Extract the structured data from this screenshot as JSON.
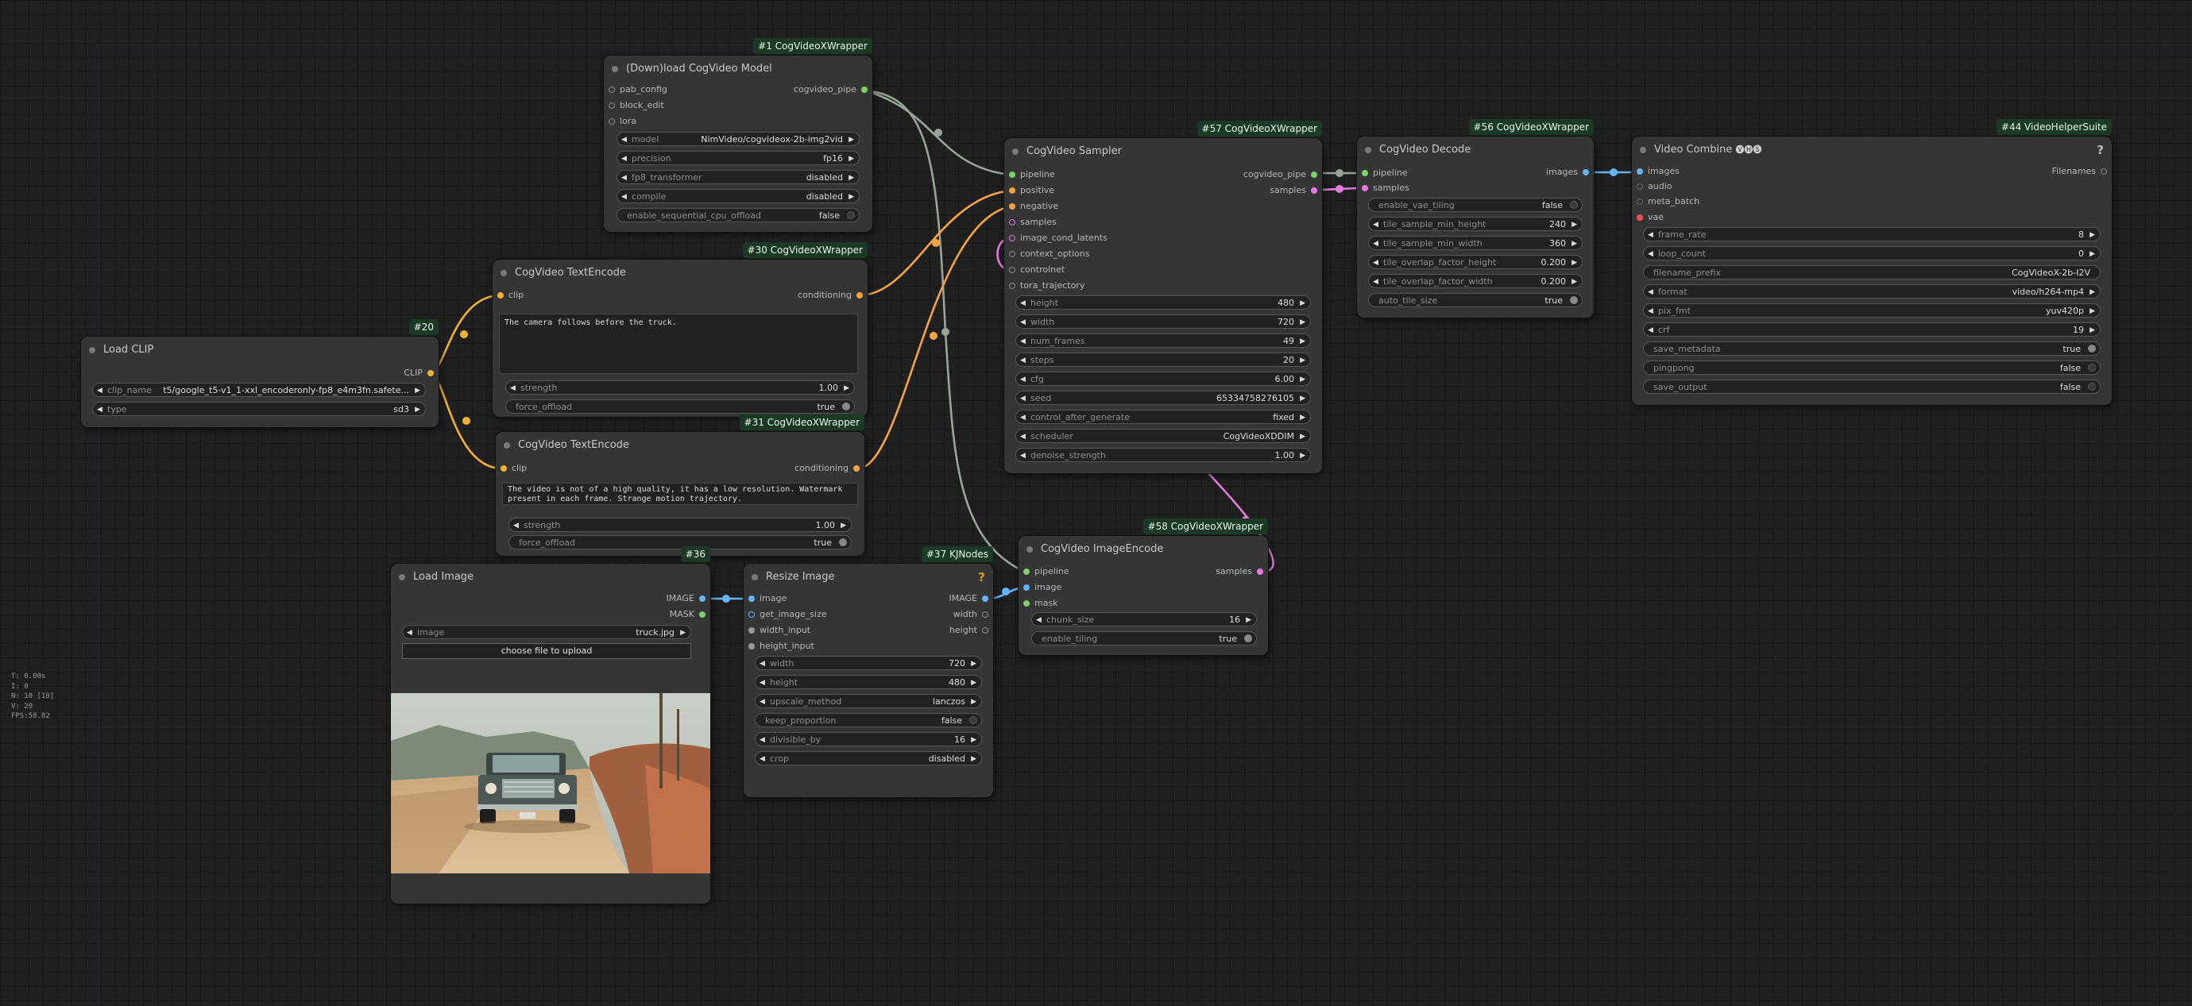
{
  "stats": [
    "T: 0.00s",
    "I: 0",
    "N: 10 [10]",
    "V: 20",
    "FPS:58.82"
  ],
  "nodes": {
    "load_model": {
      "badge": "#1 CogVideoXWrapper",
      "title": "(Down)load CogVideo Model",
      "inputs": [
        "pab_config",
        "block_edit",
        "lora"
      ],
      "output": "cogvideo_pipe",
      "widgets": [
        {
          "label": "model",
          "value": "NimVideo/cogvideox-2b-img2vid"
        },
        {
          "label": "precision",
          "value": "fp16"
        },
        {
          "label": "fp8_transformer",
          "value": "disabled"
        },
        {
          "label": "compile",
          "value": "disabled"
        }
      ],
      "toggle": {
        "label": "enable_sequential_cpu_offload",
        "value": "false"
      }
    },
    "text_encode_30": {
      "badge": "#30 CogVideoXWrapper",
      "title": "CogVideo TextEncode",
      "input": "clip",
      "output": "conditioning",
      "text": "The camera follows before the truck.",
      "strength_label": "strength",
      "strength_value": "1.00",
      "offload_label": "force_offload",
      "offload_value": "true"
    },
    "text_encode_31": {
      "badge": "#31 CogVideoXWrapper",
      "title": "CogVideo TextEncode",
      "input": "clip",
      "output": "conditioning",
      "text": "The video is not of a high quality, it has a low resolution. Watermark present in each frame. Strange motion trajectory.",
      "strength_label": "strength",
      "strength_value": "1.00",
      "offload_label": "force_offload",
      "offload_value": "true"
    },
    "load_clip": {
      "badge": "#20",
      "title": "Load CLIP",
      "output": "CLIP",
      "widgets": [
        {
          "label": "clip_name",
          "value": "t5/google_t5-v1_1-xxl_encoderonly-fp8_e4m3fn.safete..."
        },
        {
          "label": "type",
          "value": "sd3"
        }
      ]
    },
    "sampler": {
      "badge": "#57 CogVideoXWrapper",
      "title": "CogVideo Sampler",
      "inputs": [
        "pipeline",
        "positive",
        "negative",
        "samples",
        "image_cond_latents",
        "context_options",
        "controlnet",
        "tora_trajectory"
      ],
      "outputs": [
        "cogvideo_pipe",
        "samples"
      ],
      "widgets": [
        {
          "label": "height",
          "value": "480"
        },
        {
          "label": "width",
          "value": "720"
        },
        {
          "label": "num_frames",
          "value": "49"
        },
        {
          "label": "steps",
          "value": "20"
        },
        {
          "label": "cfg",
          "value": "6.00"
        },
        {
          "label": "seed",
          "value": "65334758276105"
        },
        {
          "label": "control_after_generate",
          "value": "fixed"
        },
        {
          "label": "scheduler",
          "value": "CogVideoXDDIM"
        },
        {
          "label": "denoise_strength",
          "value": "1.00"
        }
      ]
    },
    "decode": {
      "badge": "#56 CogVideoXWrapper",
      "title": "CogVideo Decode",
      "inputs": [
        "pipeline",
        "samples"
      ],
      "output": "images",
      "toggle1": {
        "label": "enable_vae_tiling",
        "value": "false"
      },
      "widgets": [
        {
          "label": "tile_sample_min_height",
          "value": "240"
        },
        {
          "label": "tile_sample_min_width",
          "value": "360"
        },
        {
          "label": "tile_overlap_factor_height",
          "value": "0.200"
        },
        {
          "label": "tile_overlap_factor_width",
          "value": "0.200"
        }
      ],
      "toggle2": {
        "label": "auto_tile_size",
        "value": "true"
      }
    },
    "video_combine": {
      "badge": "#44 VideoHelperSuite",
      "title": "Video Combine",
      "title_icons": "🅥🅗🅢",
      "inputs": [
        "images",
        "audio",
        "meta_batch",
        "vae"
      ],
      "output": "Filenames",
      "widgets": [
        {
          "label": "frame_rate",
          "value": "8"
        },
        {
          "label": "loop_count",
          "value": "0"
        }
      ],
      "prefix": {
        "label": "filename_prefix",
        "value": "CogVideoX-2b-I2V"
      },
      "widgets2": [
        {
          "label": "format",
          "value": "video/h264-mp4"
        },
        {
          "label": "pix_fmt",
          "value": "yuv420p"
        },
        {
          "label": "crf",
          "value": "19"
        }
      ],
      "toggles": [
        {
          "label": "save_metadata",
          "value": "true"
        },
        {
          "label": "pingpong",
          "value": "false"
        },
        {
          "label": "save_output",
          "value": "false"
        }
      ]
    },
    "image_encode": {
      "badge": "#58 CogVideoXWrapper",
      "title": "CogVideo ImageEncode",
      "inputs": [
        "pipeline",
        "image",
        "mask"
      ],
      "output": "samples",
      "widget": {
        "label": "chunk_size",
        "value": "16"
      },
      "toggle": {
        "label": "enable_tiling",
        "value": "true"
      }
    },
    "load_image": {
      "badge": "#36",
      "title": "Load Image",
      "outputs": [
        "IMAGE",
        "MASK"
      ],
      "widget": {
        "label": "image",
        "value": "truck.jpg"
      },
      "upload": "choose file to upload"
    },
    "resize_image": {
      "badge": "#37 KJNodes",
      "title": "Resize Image",
      "inputs": [
        "image",
        "get_image_size",
        "width_input",
        "height_input"
      ],
      "outputs": [
        "IMAGE",
        "width",
        "height"
      ],
      "widgets": [
        {
          "label": "width",
          "value": "720"
        },
        {
          "label": "height",
          "value": "480"
        },
        {
          "label": "upscale_method",
          "value": "lanczos"
        }
      ],
      "toggle": {
        "label": "keep_proportion",
        "value": "false"
      },
      "widgets2": [
        {
          "label": "divisible_by",
          "value": "16"
        },
        {
          "label": "crop",
          "value": "disabled"
        }
      ]
    }
  },
  "colors": {
    "background": "#202020",
    "node": "#353535",
    "badge": "#1a3a25",
    "clip": "#f2b233",
    "conditioning": "#f7a443",
    "pipeline": "#7fcf6a",
    "latent": "#e67ae0",
    "image": "#64b5f6",
    "vae": "#f05050"
  }
}
